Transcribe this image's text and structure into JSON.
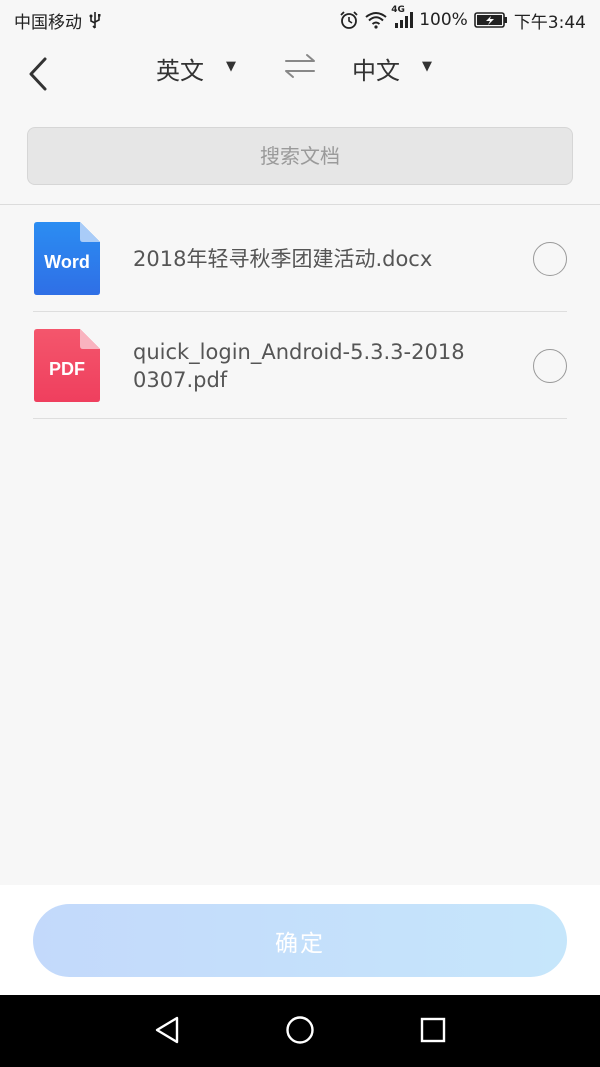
{
  "status_bar": {
    "carrier": "中国移动",
    "network": "4G",
    "battery": "100%",
    "time": "下午3:44",
    "icons": [
      "usb-icon",
      "alarm-icon",
      "wifi-icon",
      "signal-icon",
      "battery-icon"
    ]
  },
  "header": {
    "source_language": "英文",
    "target_language": "中文",
    "icons": [
      "back-arrow-icon",
      "dropdown-arrow-icon",
      "swap-icon"
    ]
  },
  "search": {
    "placeholder": "搜索文档",
    "value": ""
  },
  "files": [
    {
      "name": "2018年轻寻秋季团建活动.docx",
      "type_label": "Word",
      "icon": "word-file-icon",
      "color": "#2f7ff0",
      "selected": false
    },
    {
      "name": "quick_login_Android-5.3.3-20180307.pdf",
      "type_label": "PDF",
      "icon": "pdf-file-icon",
      "color": "#f24f68",
      "selected": false
    }
  ],
  "confirm_button": {
    "label": "确定"
  },
  "nav_bar": {
    "icons": [
      "nav-back-icon",
      "nav-home-icon",
      "nav-recent-apps-icon"
    ]
  },
  "colors": {
    "background": "#f7f7f7",
    "confirm_gradient_start": "#c3d9fb",
    "confirm_gradient_end": "#c6e6fb",
    "search_cursor": "#1a9e8f"
  }
}
